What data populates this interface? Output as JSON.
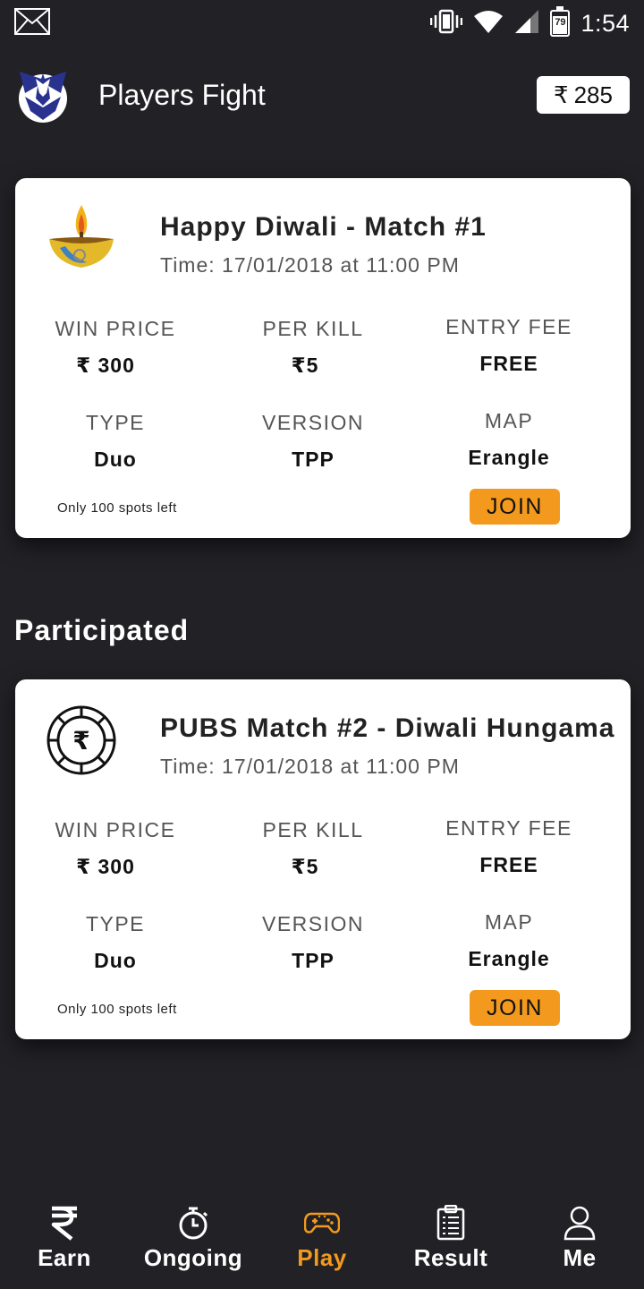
{
  "status_bar": {
    "time": "1:54",
    "battery_level": "79"
  },
  "app_bar": {
    "title": "Players Fight",
    "wallet_currency": "₹",
    "wallet_balance": "285"
  },
  "matches": [
    {
      "title": "Happy Diwali - Match #1",
      "time": "Time: 17/01/2018 at 11:00 PM",
      "win_price_label": "WIN PRICE",
      "win_price": "₹ 300",
      "per_kill_label": "PER KILL",
      "per_kill": "₹5",
      "entry_fee_label": "ENTRY FEE",
      "entry_fee": "FREE",
      "type_label": "TYPE",
      "type": "Duo",
      "version_label": "VERSION",
      "version": "TPP",
      "map_label": "MAP",
      "map": "Erangle",
      "spots_text": "Only 100 spots left",
      "join_label": "JOIN",
      "icon": "diya-lamp-icon"
    }
  ],
  "participated": {
    "heading": "Participated",
    "matches": [
      {
        "title": "PUBS Match #2 - Diwali Hungama",
        "time": "Time: 17/01/2018 at 11:00 PM",
        "win_price_label": "WIN PRICE",
        "win_price": "₹ 300",
        "per_kill_label": "PER KILL",
        "per_kill": "₹5",
        "entry_fee_label": "ENTRY FEE",
        "entry_fee": "FREE",
        "type_label": "TYPE",
        "type": "Duo",
        "version_label": "VERSION",
        "version": "TPP",
        "map_label": "MAP",
        "map": "Erangle",
        "spots_text": "Only 100 spots left",
        "join_label": "JOIN",
        "icon": "rupee-chip-icon"
      }
    ]
  },
  "bottom_nav": {
    "items": [
      {
        "label": "Earn",
        "icon": "rupee-icon",
        "active": false
      },
      {
        "label": "Ongoing",
        "icon": "stopwatch-icon",
        "active": false
      },
      {
        "label": "Play",
        "icon": "gamepad-icon",
        "active": true
      },
      {
        "label": "Result",
        "icon": "clipboard-icon",
        "active": false
      },
      {
        "label": "Me",
        "icon": "user-icon",
        "active": false
      }
    ]
  },
  "colors": {
    "background": "#222226",
    "card": "#ffffff",
    "accent": "#f39a1e"
  }
}
